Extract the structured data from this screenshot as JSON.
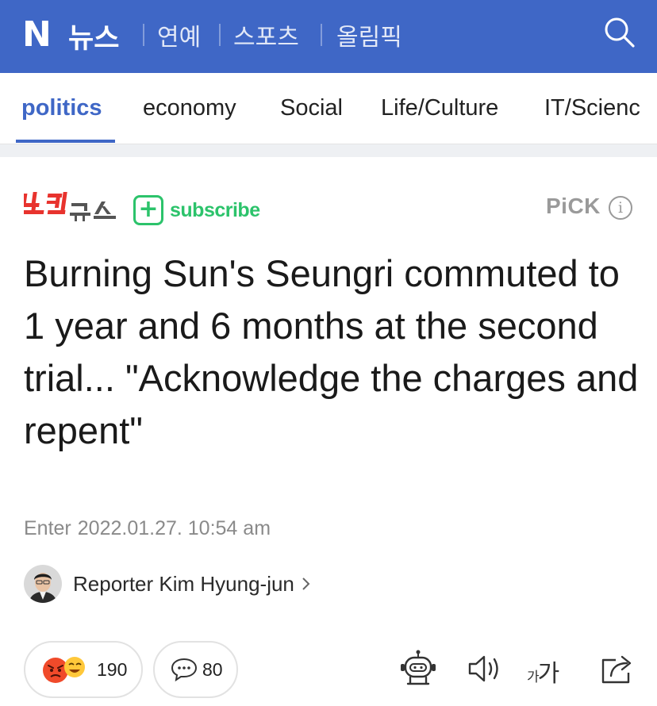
{
  "header": {
    "logo": "N",
    "brand": "뉴스",
    "links": [
      "연예",
      "스포츠",
      "올림픽"
    ]
  },
  "tabs": [
    "politics",
    "economy",
    "Social",
    "Life/Culture",
    "IT/Scienc"
  ],
  "active_tab": "politics",
  "press": {
    "logo_text": "노컷뉴스",
    "subscribe_label": "subscribe",
    "pick_label": "PiCK",
    "info_glyph": "i"
  },
  "article": {
    "headline": "Burning Sun's Seungri commuted to 1 year and 6 months at the second trial... \"Acknowledge the charges and repent\"",
    "date_label": "Enter",
    "date": "2022.01.27. 10:54 am",
    "reporter": "Reporter Kim Hyung-jun"
  },
  "actions": {
    "reaction_count": "190",
    "comment_count": "80",
    "font_size_label_small": "가",
    "font_size_label_large": "가"
  },
  "colors": {
    "brand_blue": "#3f67c6",
    "subscribe_green": "#2cc36b",
    "press_red": "#e8332e"
  }
}
